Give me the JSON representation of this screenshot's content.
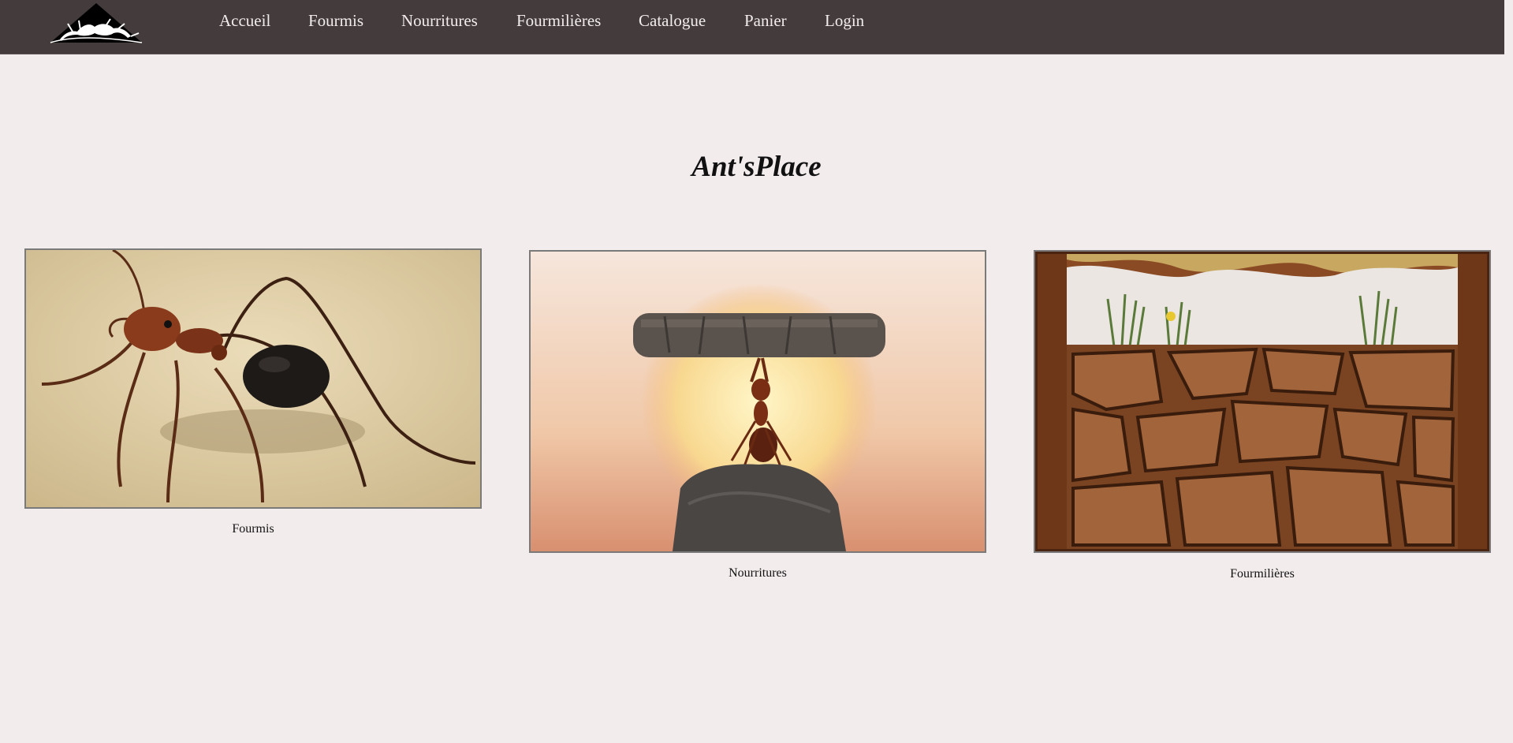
{
  "site": {
    "title": "Ant'sPlace"
  },
  "nav": {
    "items": [
      {
        "label": "Accueil"
      },
      {
        "label": "Fourmis"
      },
      {
        "label": "Nourritures"
      },
      {
        "label": "Fourmilières"
      },
      {
        "label": "Catalogue"
      },
      {
        "label": "Panier"
      },
      {
        "label": "Login"
      }
    ]
  },
  "cards": [
    {
      "caption": "Fourmis",
      "image": "ant-on-sand-photo"
    },
    {
      "caption": "Nourritures",
      "image": "ant-lifting-twig-sunset-photo"
    },
    {
      "caption": "Fourmilières",
      "image": "ant-farm-formicarium-photo"
    }
  ],
  "colors": {
    "navbar": "#443c3c",
    "page_background": "#f2eced",
    "nav_text": "#f2eced"
  }
}
